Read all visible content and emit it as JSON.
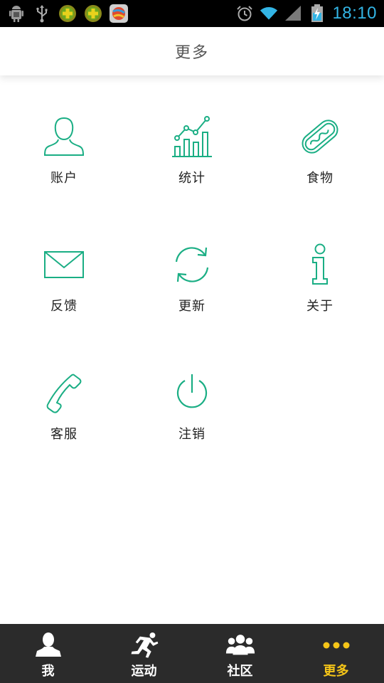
{
  "colors": {
    "accent": "#1aae84",
    "nav_bg": "#2b2b2b",
    "nav_active": "#f5c518",
    "status_time": "#33b5e5"
  },
  "status_bar": {
    "left_icons": [
      "android-debug-icon",
      "usb-icon",
      "app-plus-icon",
      "app-plus-icon",
      "app-ball-icon"
    ],
    "right_icons": [
      "alarm-icon",
      "wifi-icon",
      "signal-icon",
      "battery-charging-icon"
    ],
    "time": "18:10"
  },
  "header": {
    "title": "更多"
  },
  "grid": {
    "items": [
      {
        "label": "账户",
        "icon": "account-icon"
      },
      {
        "label": "统计",
        "icon": "statistics-icon"
      },
      {
        "label": "食物",
        "icon": "food-hotdog-icon"
      },
      {
        "label": "反馈",
        "icon": "feedback-mail-icon"
      },
      {
        "label": "更新",
        "icon": "update-refresh-icon"
      },
      {
        "label": "关于",
        "icon": "about-info-icon"
      },
      {
        "label": "客服",
        "icon": "customer-service-phone-icon"
      },
      {
        "label": "注销",
        "icon": "logout-power-icon"
      }
    ]
  },
  "bottom_nav": {
    "items": [
      {
        "label": "我",
        "icon": "person-icon",
        "active": false
      },
      {
        "label": "运动",
        "icon": "runner-icon",
        "active": false
      },
      {
        "label": "社区",
        "icon": "community-icon",
        "active": false
      },
      {
        "label": "更多",
        "icon": "more-dots-icon",
        "active": true
      }
    ]
  }
}
